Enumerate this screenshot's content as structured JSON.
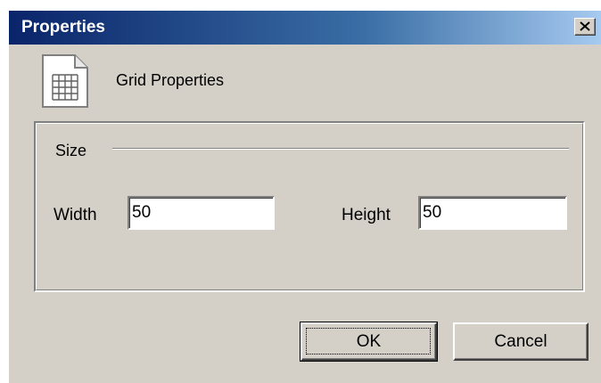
{
  "window": {
    "title": "Properties",
    "close_symbol": "✕"
  },
  "header": {
    "icon": "grid-document-icon",
    "label": "Grid Properties"
  },
  "size_group": {
    "label": "Size",
    "width": {
      "label": "Width",
      "value": "50"
    },
    "height": {
      "label": "Height",
      "value": "50"
    }
  },
  "buttons": {
    "ok": "OK",
    "cancel": "Cancel"
  },
  "colors": {
    "title_bar_start": "#0a246a",
    "title_bar_end": "#a6caf0",
    "dialog_face": "#d4d0c8"
  }
}
